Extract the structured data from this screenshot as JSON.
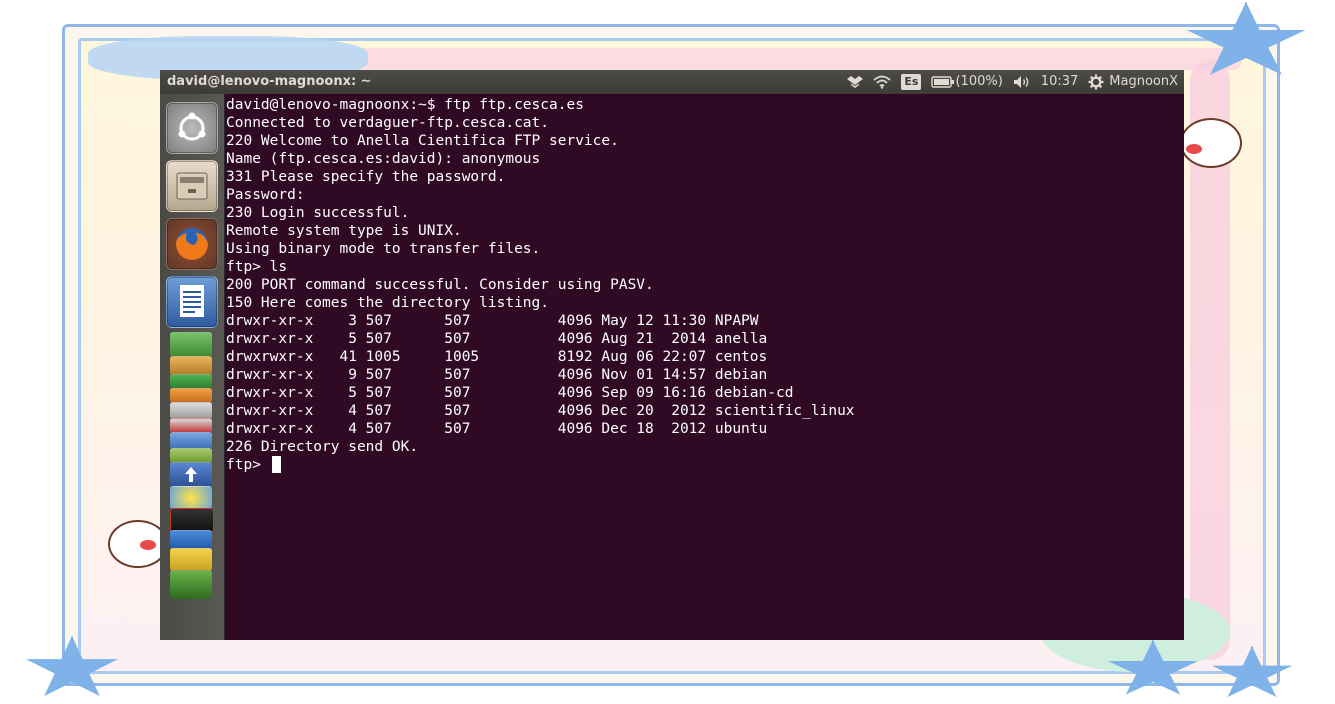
{
  "topbar": {
    "title": "david@lenovo-magnoonx: ~",
    "keyboard_layout": "Es",
    "battery": "(100%)",
    "clock": "10:37",
    "user": "MagnoonX",
    "icons": [
      "dropbox-icon",
      "wifi-icon",
      "battery-icon",
      "volume-icon",
      "gear-icon"
    ]
  },
  "launcher": {
    "items": [
      "ubuntu-dash-icon",
      "files-icon",
      "firefox-icon",
      "libreoffice-writer-icon",
      "libreoffice-calc-icon",
      "libreoffice-impress-icon",
      "software-center-icon",
      "settings-icon",
      "mail-icon",
      "upload-icon",
      "dvd-icon",
      "terminal-icon",
      "workspaces-icon",
      "folder-icon",
      "trash-icon"
    ]
  },
  "terminal": {
    "lines": [
      "david@lenovo-magnoonx:~$ ftp ftp.cesca.es",
      "Connected to verdaguer-ftp.cesca.cat.",
      "220 Welcome to Anella Cientifica FTP service.",
      "Name (ftp.cesca.es:david): anonymous",
      "331 Please specify the password.",
      "Password:",
      "230 Login successful.",
      "Remote system type is UNIX.",
      "Using binary mode to transfer files.",
      "ftp> ls",
      "200 PORT command successful. Consider using PASV.",
      "150 Here comes the directory listing.",
      "drwxr-xr-x    3 507      507          4096 May 12 11:30 NPAPW",
      "drwxr-xr-x    5 507      507          4096 Aug 21  2014 anella",
      "drwxrwxr-x   41 1005     1005         8192 Aug 06 22:07 centos",
      "drwxr-xr-x    9 507      507          4096 Nov 01 14:57 debian",
      "drwxr-xr-x    5 507      507          4096 Sep 09 16:16 debian-cd",
      "drwxr-xr-x    4 507      507          4096 Dec 20  2012 scientific_linux",
      "drwxr-xr-x    4 507      507          4096 Dec 18  2012 ubuntu",
      "226 Directory send OK."
    ],
    "prompt": "ftp> "
  },
  "colors": {
    "terminal_bg": "#300a24",
    "topbar_bg": "#3c3b37",
    "frame_blue": "#8fb6e6"
  }
}
